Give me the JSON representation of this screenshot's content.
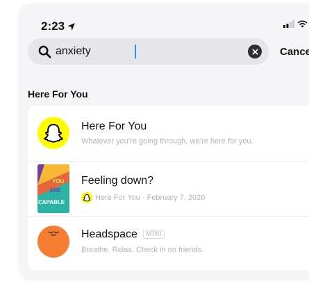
{
  "status_bar": {
    "time": "2:23"
  },
  "search": {
    "query": "anxiety",
    "cancel_label": "Cancel"
  },
  "section": {
    "title": "Here For You"
  },
  "results": [
    {
      "title": "Here For You",
      "subtitle": "Whatever you’re going through, we’re here for you.",
      "icon": "snapchat-ghost-icon"
    },
    {
      "title": "Feeling down?",
      "subtitle": "Here For You · February 7, 2020",
      "thumbnail_text": [
        "YOU",
        "ARE",
        "CAPABLE"
      ],
      "icon": "snapchat-ghost-icon"
    },
    {
      "title": "Headspace",
      "badge": "MINI",
      "subtitle": "Breathe. Relax. Check in on friends.",
      "icon": "headspace-icon"
    }
  ],
  "colors": {
    "snap_yellow": "#FFFC00",
    "headspace_orange": "#F47D31",
    "caret_blue": "#2A8CF0"
  }
}
